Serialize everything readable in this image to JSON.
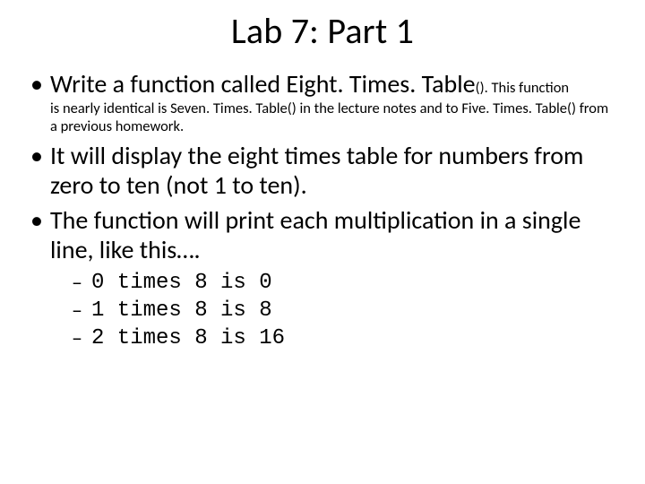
{
  "title": "Lab 7: Part 1",
  "bullets": {
    "b1_main": "Write a function called Eight. Times. Table",
    "b1_tail": "(). This function",
    "b1_sub": "is nearly identical is Seven. Times. Table() in the lecture notes and to Five. Times. Table() from a previous homework.",
    "b2": "It will display the eight times table for numbers from zero to ten (not 1 to ten).",
    "b3": "The function will print each multiplication in a single line, like this…."
  },
  "examples": [
    "0 times 8 is 0",
    "1 times 8 is 8",
    "2 times 8 is 16"
  ]
}
